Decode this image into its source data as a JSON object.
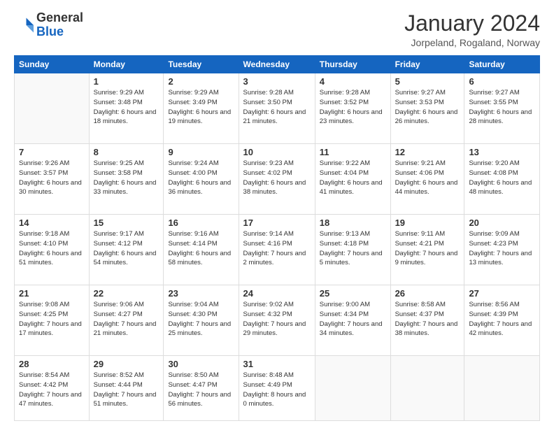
{
  "logo": {
    "general": "General",
    "blue": "Blue"
  },
  "header": {
    "month": "January 2024",
    "location": "Jorpeland, Rogaland, Norway"
  },
  "days_of_week": [
    "Sunday",
    "Monday",
    "Tuesday",
    "Wednesday",
    "Thursday",
    "Friday",
    "Saturday"
  ],
  "weeks": [
    [
      {
        "num": "",
        "empty": true
      },
      {
        "num": "1",
        "sunrise": "9:29 AM",
        "sunset": "3:48 PM",
        "daylight": "6 hours and 18 minutes."
      },
      {
        "num": "2",
        "sunrise": "9:29 AM",
        "sunset": "3:49 PM",
        "daylight": "6 hours and 19 minutes."
      },
      {
        "num": "3",
        "sunrise": "9:28 AM",
        "sunset": "3:50 PM",
        "daylight": "6 hours and 21 minutes."
      },
      {
        "num": "4",
        "sunrise": "9:28 AM",
        "sunset": "3:52 PM",
        "daylight": "6 hours and 23 minutes."
      },
      {
        "num": "5",
        "sunrise": "9:27 AM",
        "sunset": "3:53 PM",
        "daylight": "6 hours and 26 minutes."
      },
      {
        "num": "6",
        "sunrise": "9:27 AM",
        "sunset": "3:55 PM",
        "daylight": "6 hours and 28 minutes."
      }
    ],
    [
      {
        "num": "7",
        "sunrise": "9:26 AM",
        "sunset": "3:57 PM",
        "daylight": "6 hours and 30 minutes."
      },
      {
        "num": "8",
        "sunrise": "9:25 AM",
        "sunset": "3:58 PM",
        "daylight": "6 hours and 33 minutes."
      },
      {
        "num": "9",
        "sunrise": "9:24 AM",
        "sunset": "4:00 PM",
        "daylight": "6 hours and 36 minutes."
      },
      {
        "num": "10",
        "sunrise": "9:23 AM",
        "sunset": "4:02 PM",
        "daylight": "6 hours and 38 minutes."
      },
      {
        "num": "11",
        "sunrise": "9:22 AM",
        "sunset": "4:04 PM",
        "daylight": "6 hours and 41 minutes."
      },
      {
        "num": "12",
        "sunrise": "9:21 AM",
        "sunset": "4:06 PM",
        "daylight": "6 hours and 44 minutes."
      },
      {
        "num": "13",
        "sunrise": "9:20 AM",
        "sunset": "4:08 PM",
        "daylight": "6 hours and 48 minutes."
      }
    ],
    [
      {
        "num": "14",
        "sunrise": "9:18 AM",
        "sunset": "4:10 PM",
        "daylight": "6 hours and 51 minutes."
      },
      {
        "num": "15",
        "sunrise": "9:17 AM",
        "sunset": "4:12 PM",
        "daylight": "6 hours and 54 minutes."
      },
      {
        "num": "16",
        "sunrise": "9:16 AM",
        "sunset": "4:14 PM",
        "daylight": "6 hours and 58 minutes."
      },
      {
        "num": "17",
        "sunrise": "9:14 AM",
        "sunset": "4:16 PM",
        "daylight": "7 hours and 2 minutes."
      },
      {
        "num": "18",
        "sunrise": "9:13 AM",
        "sunset": "4:18 PM",
        "daylight": "7 hours and 5 minutes."
      },
      {
        "num": "19",
        "sunrise": "9:11 AM",
        "sunset": "4:21 PM",
        "daylight": "7 hours and 9 minutes."
      },
      {
        "num": "20",
        "sunrise": "9:09 AM",
        "sunset": "4:23 PM",
        "daylight": "7 hours and 13 minutes."
      }
    ],
    [
      {
        "num": "21",
        "sunrise": "9:08 AM",
        "sunset": "4:25 PM",
        "daylight": "7 hours and 17 minutes."
      },
      {
        "num": "22",
        "sunrise": "9:06 AM",
        "sunset": "4:27 PM",
        "daylight": "7 hours and 21 minutes."
      },
      {
        "num": "23",
        "sunrise": "9:04 AM",
        "sunset": "4:30 PM",
        "daylight": "7 hours and 25 minutes."
      },
      {
        "num": "24",
        "sunrise": "9:02 AM",
        "sunset": "4:32 PM",
        "daylight": "7 hours and 29 minutes."
      },
      {
        "num": "25",
        "sunrise": "9:00 AM",
        "sunset": "4:34 PM",
        "daylight": "7 hours and 34 minutes."
      },
      {
        "num": "26",
        "sunrise": "8:58 AM",
        "sunset": "4:37 PM",
        "daylight": "7 hours and 38 minutes."
      },
      {
        "num": "27",
        "sunrise": "8:56 AM",
        "sunset": "4:39 PM",
        "daylight": "7 hours and 42 minutes."
      }
    ],
    [
      {
        "num": "28",
        "sunrise": "8:54 AM",
        "sunset": "4:42 PM",
        "daylight": "7 hours and 47 minutes."
      },
      {
        "num": "29",
        "sunrise": "8:52 AM",
        "sunset": "4:44 PM",
        "daylight": "7 hours and 51 minutes."
      },
      {
        "num": "30",
        "sunrise": "8:50 AM",
        "sunset": "4:47 PM",
        "daylight": "7 hours and 56 minutes."
      },
      {
        "num": "31",
        "sunrise": "8:48 AM",
        "sunset": "4:49 PM",
        "daylight": "8 hours and 0 minutes."
      },
      {
        "num": "",
        "empty": true
      },
      {
        "num": "",
        "empty": true
      },
      {
        "num": "",
        "empty": true
      }
    ]
  ]
}
